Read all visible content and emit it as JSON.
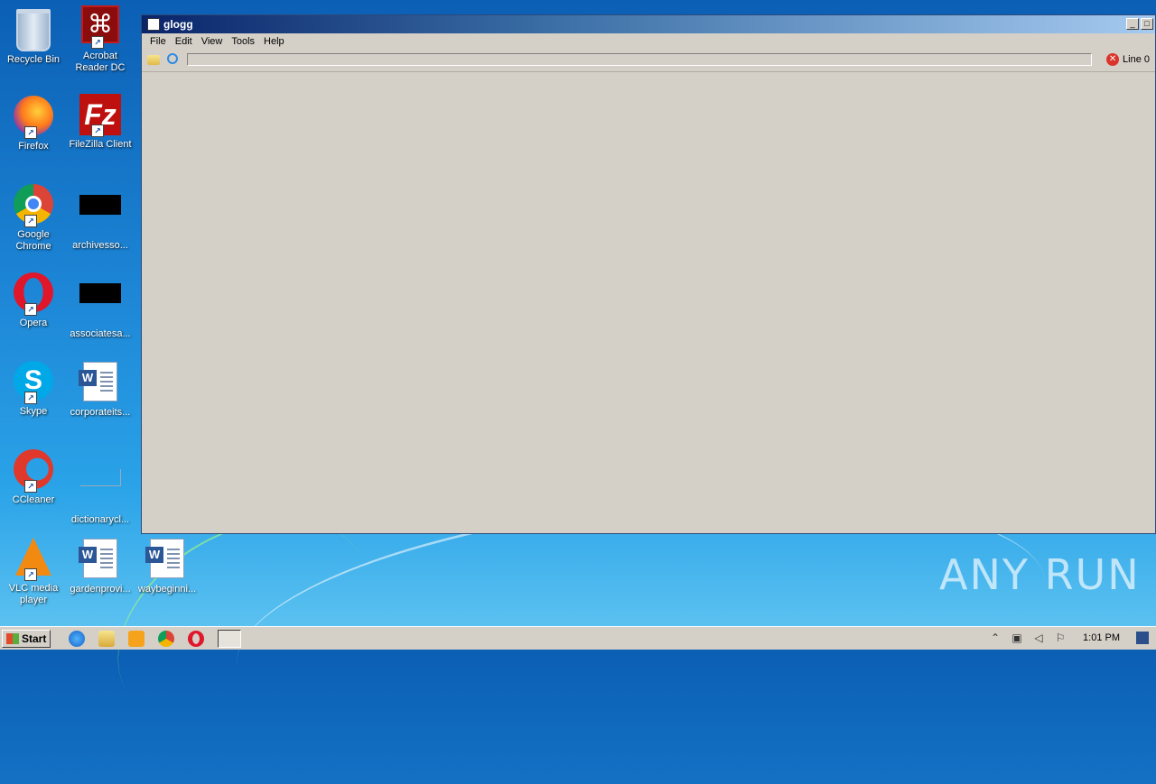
{
  "desktop": {
    "icons": [
      {
        "label": "Recycle Bin"
      },
      {
        "label": "Acrobat Reader DC"
      },
      {
        "label": "Firefox"
      },
      {
        "label": "FileZilla Client"
      },
      {
        "label": "Google Chrome"
      },
      {
        "label": "archivesso..."
      },
      {
        "label": "Opera"
      },
      {
        "label": "associatesa..."
      },
      {
        "label": "Skype"
      },
      {
        "label": "corporateits..."
      },
      {
        "label": "CCleaner"
      },
      {
        "label": "dictionarycl..."
      },
      {
        "label": "VLC media player"
      },
      {
        "label": "gardenprovi..."
      },
      {
        "label": "waybeginni..."
      }
    ],
    "watermark": "ANY RUN"
  },
  "window": {
    "title": "glogg",
    "menu": [
      "File",
      "Edit",
      "View",
      "Tools",
      "Help"
    ],
    "status_text": "Line 0",
    "search_value": ""
  },
  "taskbar": {
    "start_label": "Start",
    "clock": "1:01 PM"
  },
  "colors": {
    "desktop_blue": "#1d86d6",
    "window_bg": "#d4d0c8",
    "title_gradient_start": "#0a246a",
    "error_red": "#d9352b"
  }
}
